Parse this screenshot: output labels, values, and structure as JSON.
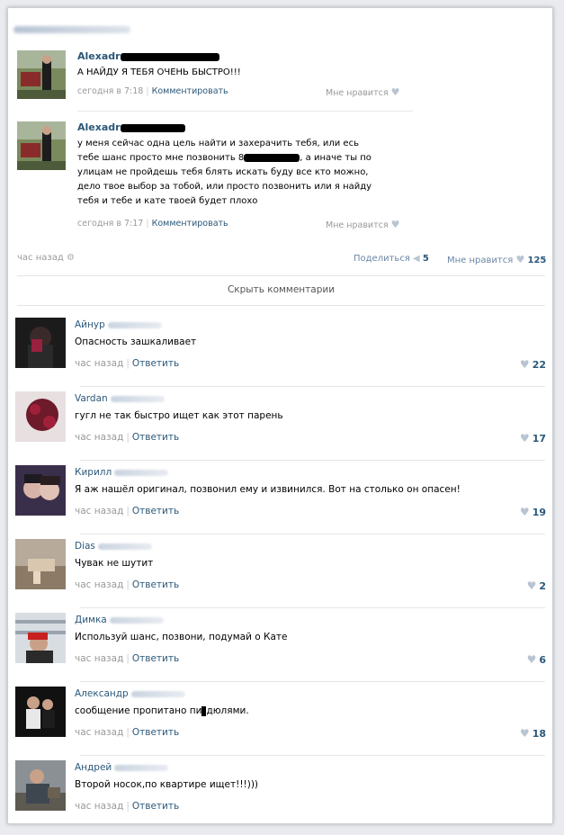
{
  "post_comments": [
    {
      "name": "Alexadr",
      "text": "А НАЙДУ Я ТЕБЯ ОЧЕНЬ БЫСТРО!!!",
      "time": "сегодня в 7:18",
      "reply": "Комментировать",
      "like": "Мне нравится"
    },
    {
      "name": "Alexadr",
      "text_lines": [
        "у меня сейчас одна цель найти и захерачить тебя, или есь",
        "тебе шанс просто мне позвонить 8",
        "улицам не пройдешь тебя блять искать буду все кто можно,",
        "дело твое выбор за тобой, или просто позвонить или я найду",
        "тебя и тебе и кате твоей будет плохо"
      ],
      "text_line2_tail": ", а иначе ты по",
      "time": "сегодня в 7:17",
      "reply": "Комментировать",
      "like": "Мне нравится"
    }
  ],
  "post_footer": {
    "time": "час назад",
    "share_label": "Поделиться",
    "share_count": "5",
    "likes_label": "Мне нравится",
    "likes_count": "125"
  },
  "hide_comments": "Скрыть комментарии",
  "comments": [
    {
      "name": "Айнур",
      "text": "Опасность зашкаливает",
      "time": "час назад",
      "reply": "Ответить",
      "likes": "22"
    },
    {
      "name": "Vardan",
      "text": "гугл не так быстро ищет как этот парень",
      "time": "час назад",
      "reply": "Ответить",
      "likes": "17"
    },
    {
      "name": "Кирилл",
      "text": "Я аж нашёл оригинал, позвонил ему и извинился. Вот на столько он опасен!",
      "time": "час назад",
      "reply": "Ответить",
      "likes": "19"
    },
    {
      "name": "Dias",
      "text": "Чувак не шутит",
      "time": "час назад",
      "reply": "Ответить",
      "likes": "2"
    },
    {
      "name": "Димка",
      "text": "Используй шанс, позвони, подумай о Кате",
      "time": "час назад",
      "reply": "Ответить",
      "likes": "6"
    },
    {
      "name": "Александр",
      "text_a": "сообщение пропитано пи",
      "text_b": "дюлями.",
      "time": "час назад",
      "reply": "Ответить",
      "likes": "18"
    },
    {
      "name": "Андрей",
      "text": "Второй носок,по квартире ищет!!!)))",
      "time": "час назад",
      "reply": "Ответить",
      "likes": ""
    }
  ],
  "colors": {
    "link": "#2b587a",
    "muted": "#999999",
    "heart": "#b9c4d2"
  }
}
